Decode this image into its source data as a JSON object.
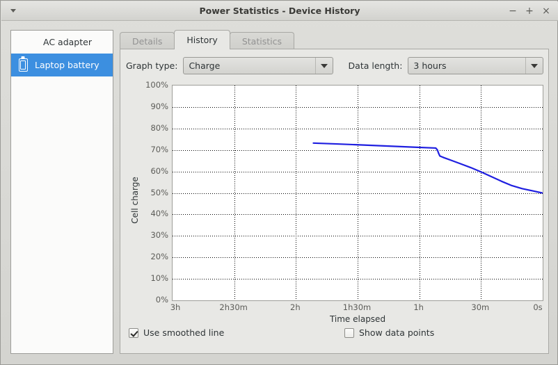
{
  "window": {
    "title": "Power Statistics - Device History",
    "menu_icon": "caret-down-icon",
    "minimize_label": "−",
    "maximize_label": "+",
    "close_label": "×"
  },
  "sidebar": {
    "items": [
      {
        "label": "AC adapter",
        "icon": "",
        "selected": false
      },
      {
        "label": "Laptop battery",
        "icon": "battery-icon",
        "selected": true
      }
    ]
  },
  "tabs": [
    {
      "label": "Details",
      "active": false
    },
    {
      "label": "History",
      "active": true
    },
    {
      "label": "Statistics",
      "active": false
    }
  ],
  "controls": {
    "graph_type_label": "Graph type:",
    "graph_type_value": "Charge",
    "data_length_label": "Data length:",
    "data_length_value": "3 hours",
    "dropdown_icon": "chevron-down-icon"
  },
  "options": {
    "smoothed_label": "Use smoothed line",
    "smoothed_checked": true,
    "points_label": "Show data points",
    "points_checked": false
  },
  "chart_data": {
    "type": "line",
    "title": "",
    "xlabel": "Time elapsed",
    "ylabel": "Cell charge",
    "line_color": "#1f1fe0",
    "grid": true,
    "legend": "none",
    "xlim": [
      180,
      0
    ],
    "ylim": [
      0,
      100
    ],
    "x_tick_values": [
      180,
      150,
      120,
      90,
      60,
      30,
      0
    ],
    "x_tick_labels": [
      "3h",
      "2h30m",
      "2h",
      "1h30m",
      "1h",
      "30m",
      "0s"
    ],
    "y_tick_values": [
      100,
      90,
      80,
      70,
      60,
      50,
      40,
      30,
      20,
      10,
      0
    ],
    "y_tick_labels": [
      "100%",
      "90%",
      "80%",
      "70%",
      "60%",
      "50%",
      "40%",
      "30%",
      "20%",
      "10%",
      "0%"
    ],
    "x_gridlines": [
      150,
      120,
      90,
      60,
      30
    ],
    "y_gridlines": [
      90,
      80,
      70,
      60,
      50,
      40,
      30,
      20,
      10
    ],
    "series": [
      {
        "name": "Cell charge",
        "unit": "%",
        "points": [
          [
            111.5,
            73.2
          ],
          [
            100.0,
            72.8
          ],
          [
            90.0,
            72.4
          ],
          [
            80.0,
            72.0
          ],
          [
            70.0,
            71.6
          ],
          [
            60.0,
            71.2
          ],
          [
            52.0,
            70.9
          ],
          [
            51.2,
            70.0
          ],
          [
            50.6,
            68.4
          ],
          [
            50.0,
            67.2
          ],
          [
            48.0,
            66.4
          ],
          [
            44.0,
            65.0
          ],
          [
            40.0,
            63.6
          ],
          [
            35.0,
            61.8
          ],
          [
            30.0,
            59.8
          ],
          [
            25.0,
            57.6
          ],
          [
            20.0,
            55.4
          ],
          [
            15.0,
            53.4
          ],
          [
            10.0,
            52.0
          ],
          [
            5.0,
            51.0
          ],
          [
            0.3,
            50.0
          ]
        ]
      }
    ]
  }
}
